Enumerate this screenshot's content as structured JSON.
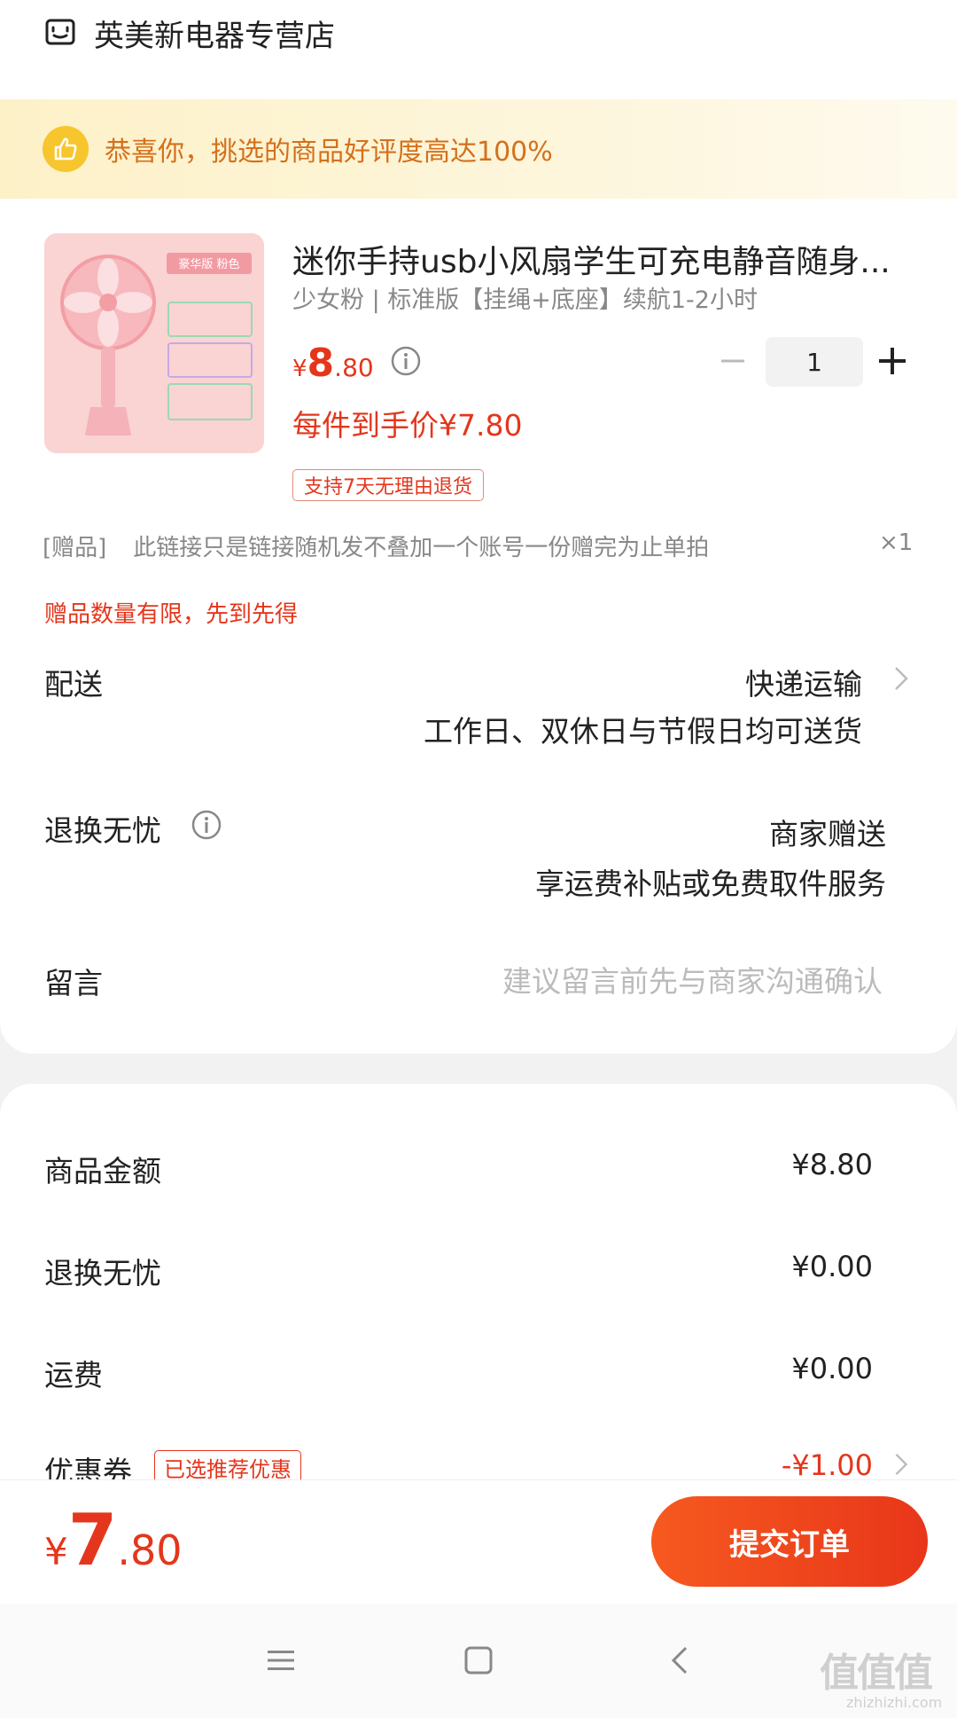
{
  "shop": {
    "name": "英美新电器专营店",
    "icon": "shop-icon"
  },
  "banner": {
    "text": "恭喜你，挑选的商品好评度高达100%",
    "icon": "thumbs-up-icon"
  },
  "product": {
    "title": "迷你手持usb小风扇学生可充电静音随身...",
    "spec": "少女粉 | 标准版【挂绳+底座】续航1-2小时",
    "price_yen": "¥",
    "price_int": "8",
    "price_dec": ".80",
    "quantity": "1",
    "unit_price": "每件到手价¥7.80",
    "return_tag": "支持7天无理由退货",
    "image_labels": {
      "top": "豪华版 粉色"
    }
  },
  "gift": {
    "tag": "[赠品]",
    "text": "此链接只是链接随机发不叠加一个账号一份赠完为止单拍",
    "count": "×1",
    "limit": "赠品数量有限，先到先得"
  },
  "delivery": {
    "label": "配送",
    "method": "快递运输",
    "note": "工作日、双休日与节假日均可送货"
  },
  "returns": {
    "label": "退换无忧",
    "value": "商家赠送",
    "note": "享运费补贴或免费取件服务"
  },
  "message": {
    "label": "留言",
    "placeholder": "建议留言前先与商家沟通确认"
  },
  "summary": {
    "goods_label": "商品金额",
    "goods_value": "¥8.80",
    "returns_label": "退换无忧",
    "returns_value": "¥0.00",
    "shipping_label": "运费",
    "shipping_value": "¥0.00",
    "coupon_label": "优惠券",
    "coupon_tag": "已选推荐优惠",
    "coupon_value": "-¥1.00"
  },
  "footer": {
    "total_yen": "¥",
    "total_int": "7",
    "total_dec": ".80",
    "submit": "提交订单"
  },
  "watermark": {
    "text": "值值值",
    "sub": "zhizhizhi.com"
  },
  "colors": {
    "accent": "#e4361c",
    "banner_text": "#d5701c",
    "banner_bg": "#fdf1c8"
  }
}
